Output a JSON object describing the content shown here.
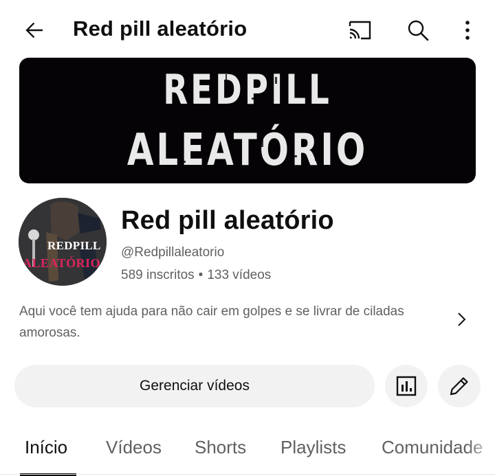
{
  "header": {
    "title": "Red pill aleatório",
    "back_icon": "arrow-back-icon",
    "cast_icon": "cast-icon",
    "search_icon": "search-icon",
    "more_icon": "more-vert-icon"
  },
  "banner": {
    "line1": "REDPILL",
    "line2": "ALEATÓRIO"
  },
  "avatar": {
    "line1": "REDPILL",
    "line2": "ALEATÓRIO"
  },
  "channel": {
    "name": "Red pill aleatório",
    "handle": "@Redpillaleatorio",
    "subscribers": "589 inscritos",
    "separator": "•",
    "videos": "133 vídeos",
    "description": "Aqui você tem ajuda para não cair em golpes e se livrar de ciladas amorosas."
  },
  "actions": {
    "manage_label": "Gerenciar vídeos",
    "analytics_icon": "analytics-icon",
    "edit_icon": "edit-pencil-icon"
  },
  "tabs": [
    {
      "label": "Início",
      "active": true
    },
    {
      "label": "Vídeos",
      "active": false
    },
    {
      "label": "Shorts",
      "active": false
    },
    {
      "label": "Playlists",
      "active": false
    },
    {
      "label": "Comunidade",
      "active": false
    }
  ],
  "colors": {
    "text_primary": "#0f0f0f",
    "text_secondary": "#606060",
    "button_bg": "#f2f2f2",
    "banner_bg": "#060307",
    "avatar_accent": "#e0245e"
  }
}
